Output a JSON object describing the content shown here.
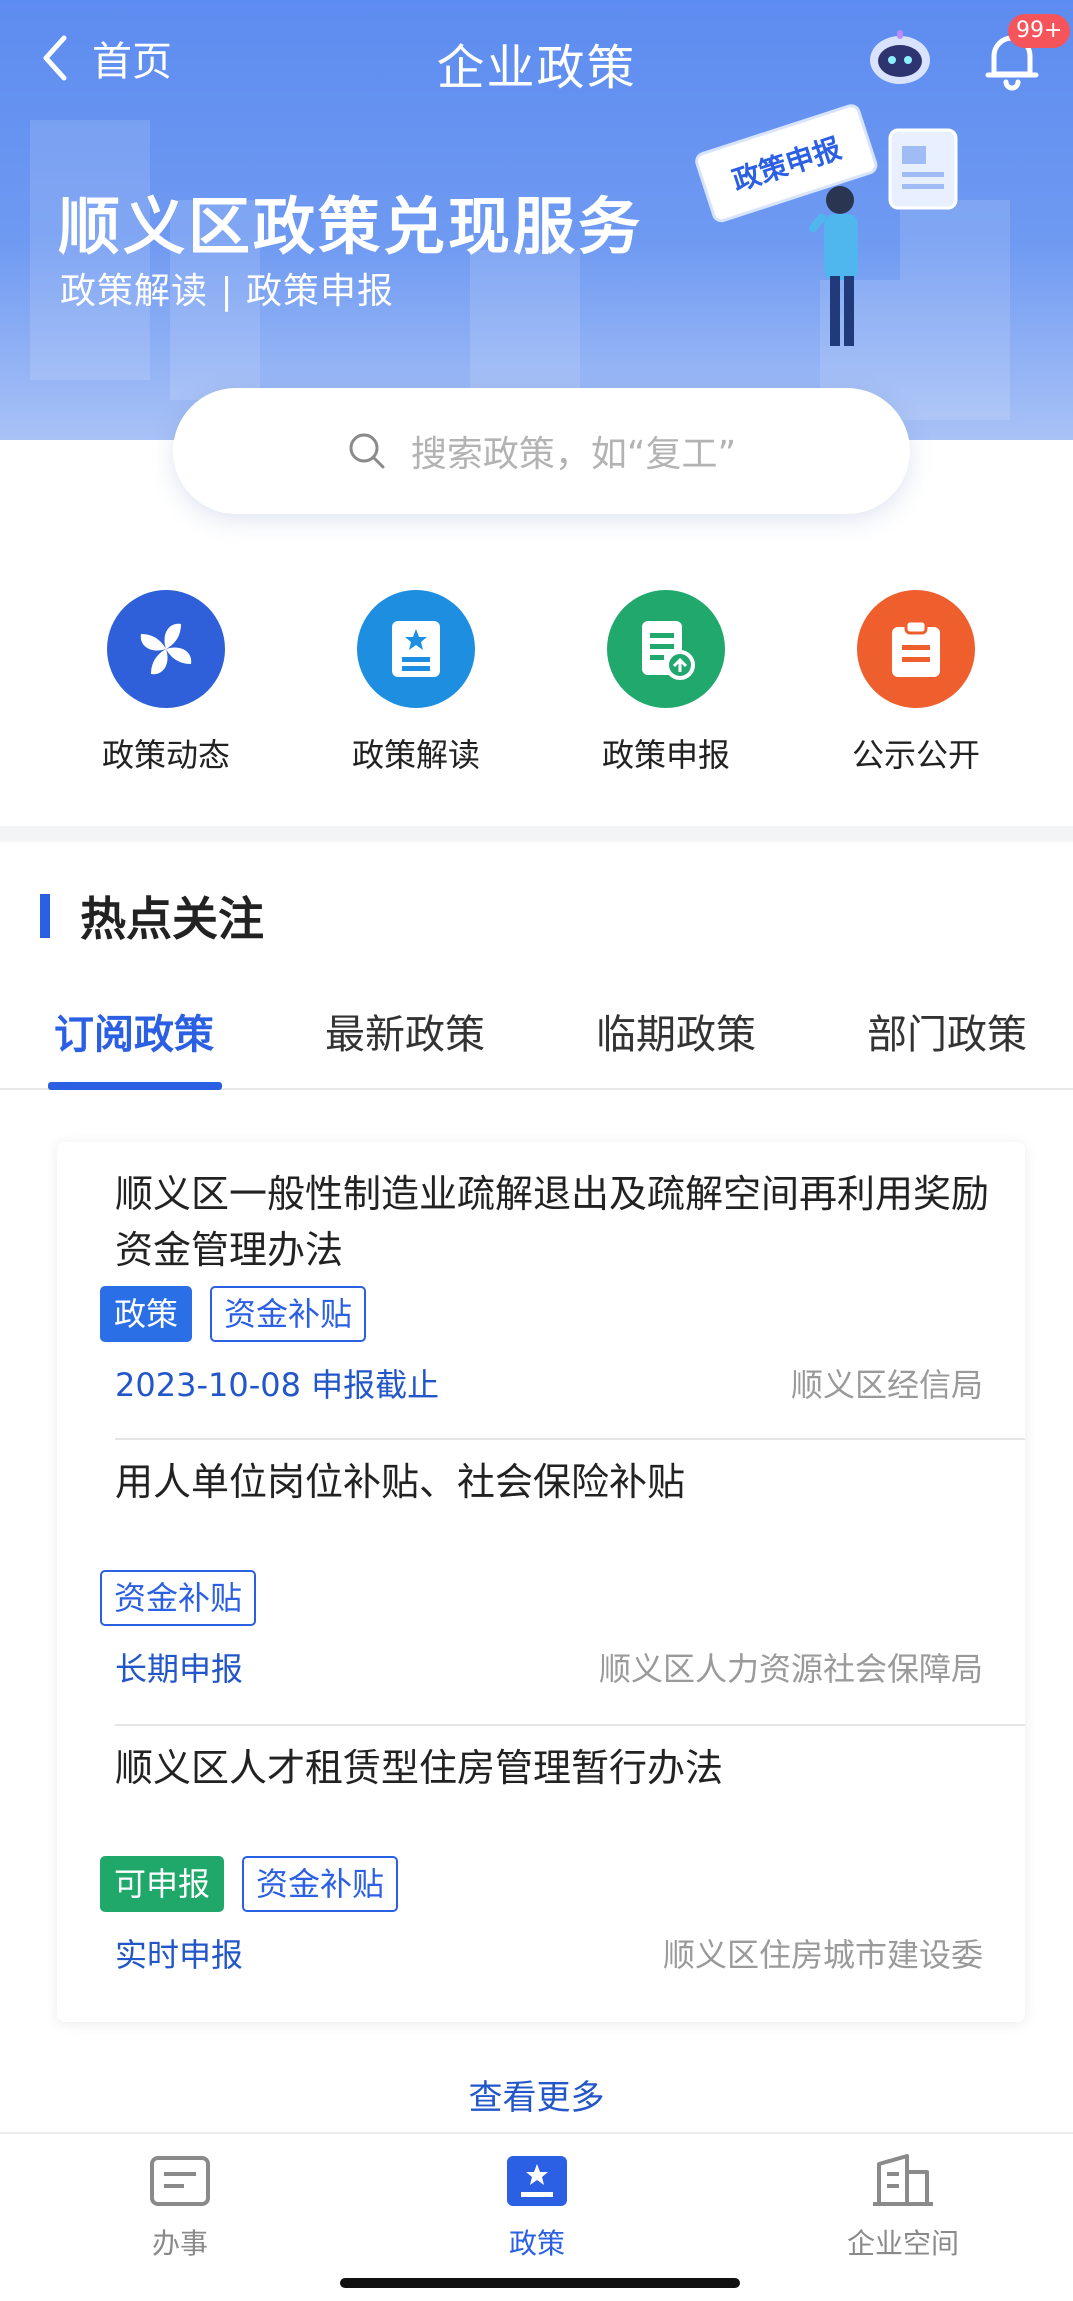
{
  "header": {
    "back_label": "首页",
    "title": "企业政策",
    "badge": "99+"
  },
  "hero": {
    "title": "顺义区政策兑现服务",
    "subtitle": "政策解读 | 政策申报",
    "illustration_sign": "政策申报"
  },
  "search": {
    "placeholder": "搜索政策，如“复工”"
  },
  "quick_links": [
    {
      "label": "政策动态",
      "icon": "pinwheel-icon",
      "color": "#2f5fd9"
    },
    {
      "label": "政策解读",
      "icon": "document-star-icon",
      "color": "#1e8fe0"
    },
    {
      "label": "政策申报",
      "icon": "document-upload-icon",
      "color": "#21a86c"
    },
    {
      "label": "公示公开",
      "icon": "clipboard-icon",
      "color": "#ef5f2e"
    }
  ],
  "section": {
    "title": "热点关注"
  },
  "tabs": [
    {
      "label": "订阅政策",
      "active": true
    },
    {
      "label": "最新政策",
      "active": false
    },
    {
      "label": "临期政策",
      "active": false
    },
    {
      "label": "部门政策",
      "active": false
    }
  ],
  "policies": [
    {
      "title": "顺义区一般性制造业疏解退出及疏解空间再利用奖励资金管理办法",
      "tags": [
        "政策",
        "资金补贴"
      ],
      "deadline": "2023-10-08 申报截止",
      "department": "顺义区经信局"
    },
    {
      "title": "用人单位岗位补贴、社会保险补贴",
      "tags": [
        "资金补贴"
      ],
      "deadline": "长期申报",
      "department": "顺义区人力资源社会保障局"
    },
    {
      "title": "顺义区人才租赁型住房管理暂行办法",
      "tags": [
        "可申报",
        "资金补贴"
      ],
      "deadline": "实时申报",
      "department": "顺义区住房城市建设委"
    }
  ],
  "more_label": "查看更多",
  "bottom_nav": [
    {
      "label": "办事",
      "icon": "tasks-icon",
      "active": false
    },
    {
      "label": "政策",
      "icon": "policy-icon",
      "active": true
    },
    {
      "label": "企业空间",
      "icon": "building-icon",
      "active": false
    }
  ],
  "colors": {
    "primary": "#2b5fe4",
    "green": "#1fa86a",
    "orange": "#ef5f2e",
    "badge": "#f5545a"
  }
}
